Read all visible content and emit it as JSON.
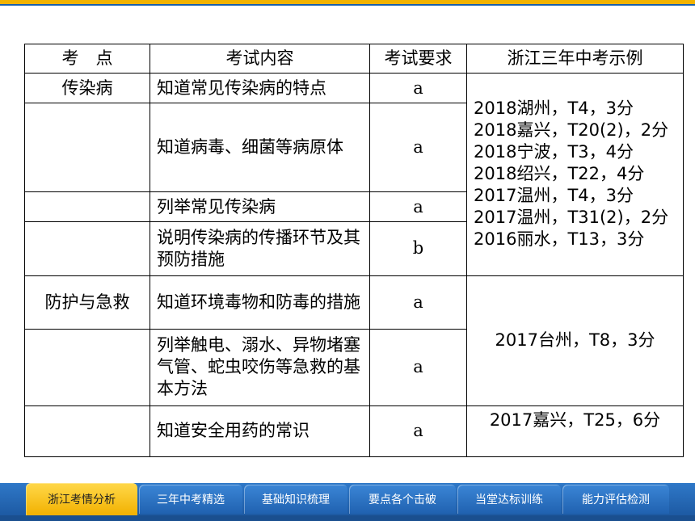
{
  "table": {
    "headers": [
      "考　点",
      "考试内容",
      "考试要求",
      "浙江三年中考示例"
    ],
    "rows": [
      {
        "topic": "传染病",
        "content": "知道常见传染病的特点",
        "req": "a"
      },
      {
        "topic": "",
        "content": "知道病毒、细菌等病原体",
        "req": "a"
      },
      {
        "topic": "",
        "content": "列举常见传染病",
        "req": "a"
      },
      {
        "topic": "",
        "content": "说明传染病的传播环节及其预防措施",
        "req": "b"
      },
      {
        "topic": "防护与急救",
        "content": "知道环境毒物和防毒的措施",
        "req": "a"
      },
      {
        "topic": "",
        "content": "列举触电、溺水、异物堵塞气管、蛇虫咬伤等急救的基本方法",
        "req": "a"
      },
      {
        "topic": "",
        "content": "知道安全用药的常识",
        "req": "a"
      }
    ],
    "examples_group1": [
      "2018湖州，T4，3分",
      "2018嘉兴，T20(2)，2分",
      "2018宁波，T3，4分",
      "2018绍兴，T22，4分",
      "2017温州，T4，3分",
      "2017温州，T31(2)，2分",
      "2016丽水，T13，3分"
    ],
    "examples_group2": [
      "2017台州，T8，3分"
    ],
    "examples_group3": [
      "2017嘉兴，T25，6分"
    ]
  },
  "nav": {
    "tabs": [
      "浙江考情分析",
      "三年中考精选",
      "基础知识梳理",
      "要点各个击破",
      "当堂达标训练",
      "能力评估检测"
    ],
    "active_index": 0
  },
  "colors": {
    "accent": "#f2b300",
    "nav_blue": "#2a6fc0"
  }
}
